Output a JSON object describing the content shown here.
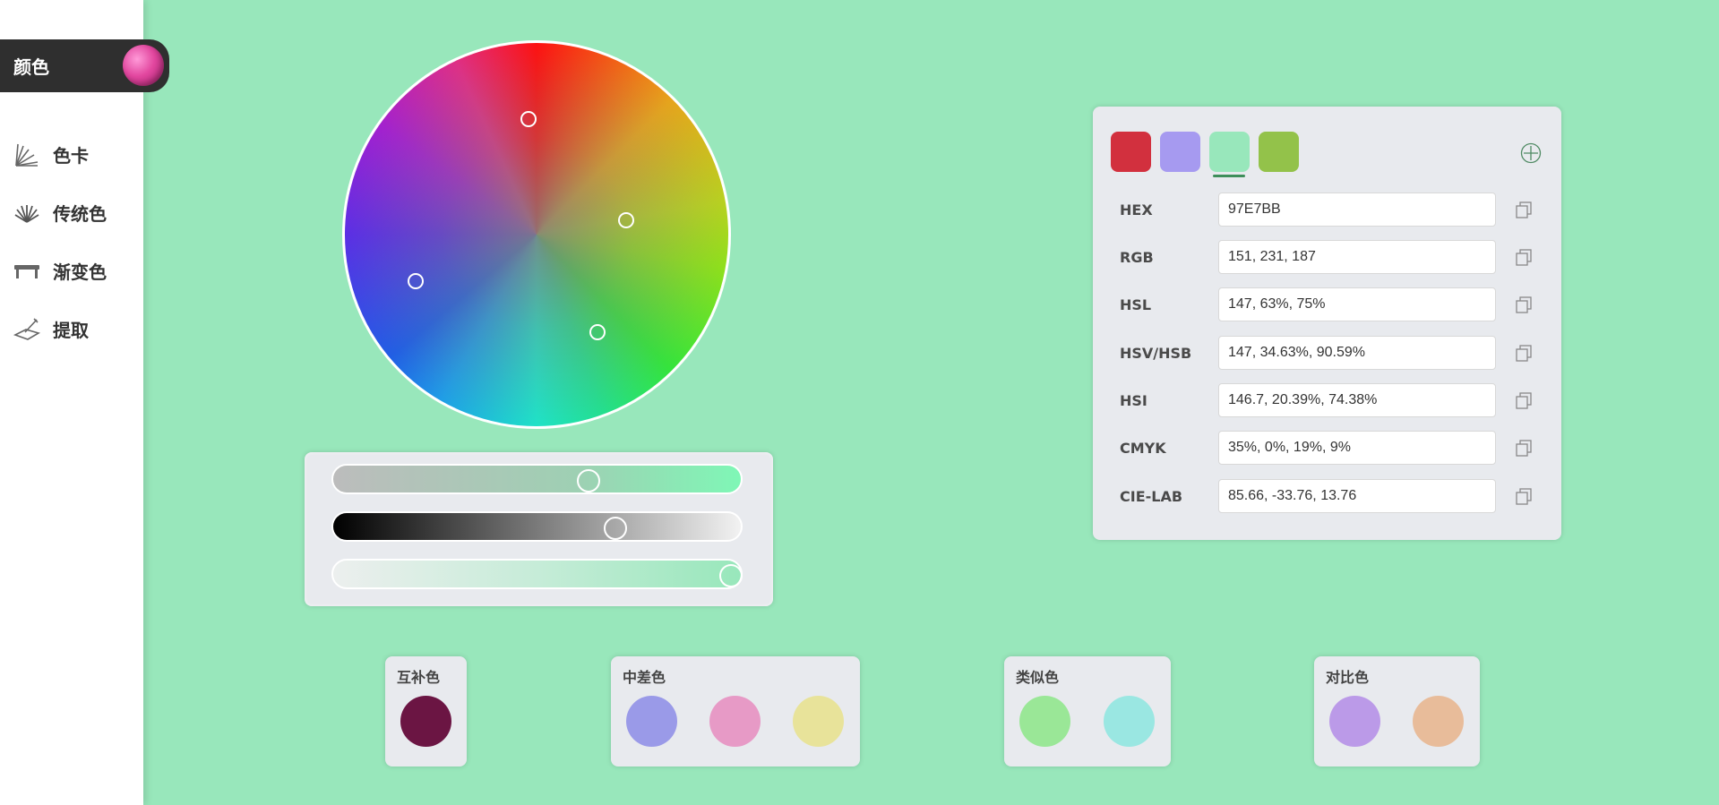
{
  "sidebar": {
    "brand_label": "颜色",
    "items": [
      {
        "label": "色卡",
        "icon": "color-fan-deck-icon"
      },
      {
        "label": "传统色",
        "icon": "folding-fan-icon"
      },
      {
        "label": "渐变色",
        "icon": "gradient-bench-icon"
      },
      {
        "label": "提取",
        "icon": "eyedropper-extract-icon"
      }
    ]
  },
  "wheel": {
    "handle_colors": [
      "#e0475e",
      "#a69af0",
      "#98E7BB",
      "#9ac04a"
    ]
  },
  "sliders": {
    "saturation": 0.63,
    "value": 0.7,
    "alpha": 1.0
  },
  "swatches": [
    {
      "color": "#D2303E",
      "selected": false
    },
    {
      "color": "#A69AF0",
      "selected": false
    },
    {
      "color": "#98E7BB",
      "selected": true
    },
    {
      "color": "#93C24A",
      "selected": false
    }
  ],
  "add_icon": "plus-circle-icon",
  "formats": [
    {
      "label": "HEX",
      "value": "97E7BB"
    },
    {
      "label": "RGB",
      "value": "151, 231, 187"
    },
    {
      "label": "HSL",
      "value": "147, 63%, 75%"
    },
    {
      "label": "HSV/HSB",
      "value": "147, 34.63%, 90.59%"
    },
    {
      "label": "HSI",
      "value": "146.7, 20.39%, 74.38%"
    },
    {
      "label": "CMYK",
      "value": "35%, 0%, 19%, 9%"
    },
    {
      "label": "CIE-LAB",
      "value": "85.66, -33.76, 13.76"
    }
  ],
  "copy_icon": "copy-icon",
  "harmonies": [
    {
      "title": "互补色",
      "colors": [
        "#6B1543"
      ]
    },
    {
      "title": "中差色",
      "colors": [
        "#9A9AE8",
        "#E79AC6",
        "#E8E39A"
      ]
    },
    {
      "title": "类似色",
      "colors": [
        "#9AE797",
        "#9AE7E2"
      ]
    },
    {
      "title": "对比色",
      "colors": [
        "#BB9AE8",
        "#E8BC9A"
      ]
    }
  ]
}
